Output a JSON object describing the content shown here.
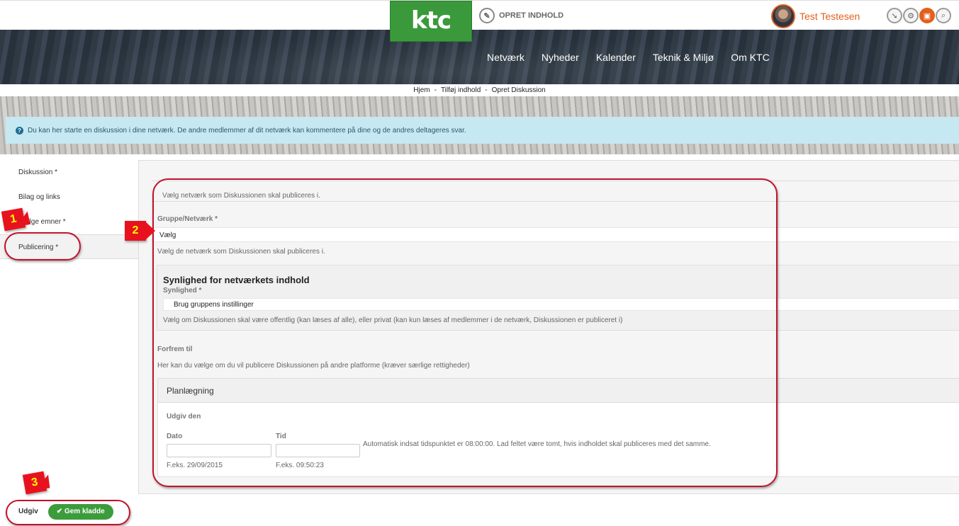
{
  "header": {
    "logo_text": "ktc",
    "create_label": "OPRET INDHOLD",
    "user_name": "Test Testesen",
    "tools": [
      {
        "icon": "pin-icon",
        "glyph": "➘"
      },
      {
        "icon": "gear-icon",
        "glyph": "⚙"
      },
      {
        "icon": "lock-icon",
        "glyph": "🔓"
      },
      {
        "icon": "search-icon",
        "glyph": "⌕"
      }
    ]
  },
  "nav": [
    "Netværk",
    "Nyheder",
    "Kalender",
    "Teknik & Miljø",
    "Om KTC"
  ],
  "breadcrumb": [
    "Hjem",
    "Tilføj indhold",
    "Opret Diskussion"
  ],
  "info_text": "Du kan her starte en diskussion i dine netværk. De andre medlemmer af dit netværk kan kommentere på dine og de andres deltageres svar.",
  "sidebar": [
    "Diskussion *",
    "Bilag og links",
    "Vælge emner *",
    "Publicering *"
  ],
  "form": {
    "intro_hint": "Vælg netværk som Diskussionen skal publiceres i.",
    "group_label": "Gruppe/Netværk *",
    "group_value": "Vælg",
    "group_hint": "Vælg de netværk som Diskussionen skal publiceres i.",
    "visibility_heading": "Synlighed for netværkets indhold",
    "visibility_label": "Synlighed *",
    "visibility_value": "Brug gruppens instillinger",
    "visibility_hint": "Vælg om Diskussionen skal være offentlig (kan læses af alle), eller privat (kan kun læses af medlemmer i de netværk, Diskussionen er publiceret i)",
    "promote_label": "Forfrem til",
    "promote_hint": "Her kan du vælge om du vil publicere Diskussionen på andre platforme (kræver særlige rettigheder)",
    "planning_heading": "Planlægning",
    "publish_label": "Udgiv den",
    "date_label": "Dato",
    "time_label": "Tid",
    "auto_hint": "Automatisk indsat tidspunktet er 08:00:00. Lad feltet være tomt, hvis indholdet skal publiceres med det samme.",
    "date_example": "F.eks. 29/09/2015",
    "time_example": "F.eks. 09:50:23"
  },
  "buttons": {
    "publish": "Udgiv",
    "save_draft": "Gem kladde"
  },
  "annotations": [
    "1",
    "2",
    "3"
  ],
  "colors": {
    "brand_green": "#3a9a3b",
    "accent_orange": "#e35f1d",
    "annotation_red": "#e8121e",
    "info_bg": "#c6e8f3"
  }
}
